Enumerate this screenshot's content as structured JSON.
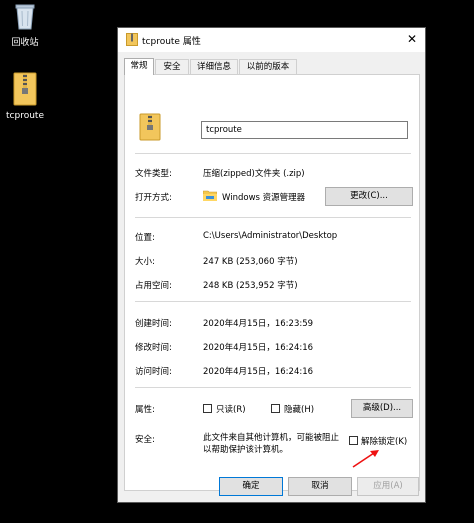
{
  "desktop": {
    "recycle_bin_label": "回收站",
    "file_label": "tcproute"
  },
  "dialog": {
    "title": "tcproute 属性",
    "tabs": [
      "常规",
      "安全",
      "详细信息",
      "以前的版本"
    ],
    "name_value": "tcproute",
    "file_type_label": "文件类型:",
    "file_type_value": "压缩(zipped)文件夹 (.zip)",
    "opens_with_label": "打开方式:",
    "opens_with_value": "Windows 资源管理器",
    "change_button": "更改(C)...",
    "location_label": "位置:",
    "location_value": "C:\\Users\\Administrator\\Desktop",
    "size_label": "大小:",
    "size_value": "247 KB (253,060 字节)",
    "size_on_disk_label": "占用空间:",
    "size_on_disk_value": "248 KB (253,952 字节)",
    "created_label": "创建时间:",
    "created_value": "2020年4月15日，16:23:59",
    "modified_label": "修改时间:",
    "modified_value": "2020年4月15日，16:24:16",
    "accessed_label": "访问时间:",
    "accessed_value": "2020年4月15日，16:24:16",
    "attributes_label": "属性:",
    "readonly_label": "只读(R)",
    "hidden_label": "隐藏(H)",
    "advanced_button": "高级(D)...",
    "security_label": "安全:",
    "security_text_1": "此文件来自其他计算机，可能被阻止",
    "security_text_2": "以帮助保护该计算机。",
    "unblock_label": "解除锁定(K)",
    "ok_button": "确定",
    "cancel_button": "取消",
    "apply_button": "应用(A)"
  }
}
